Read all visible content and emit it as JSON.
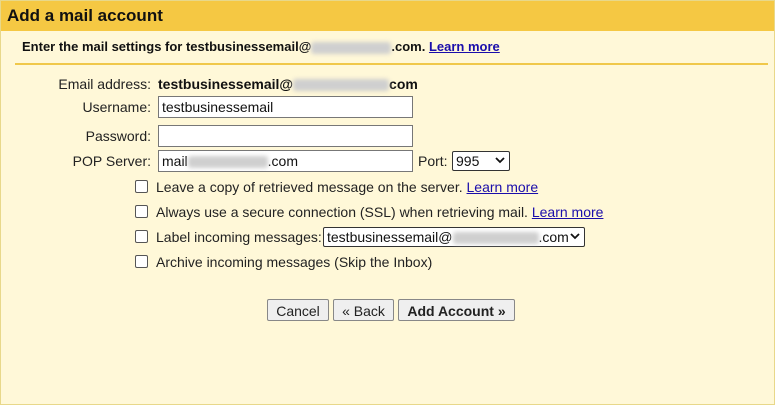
{
  "title": "Add a mail account",
  "intro": {
    "text_prefix": "Enter the mail settings for testbusinessemail@",
    "text_suffix": ".com.",
    "learn_more": "Learn more"
  },
  "form": {
    "email_label": "Email address:",
    "email_prefix": "testbusinessemail@",
    "email_suffix": "com",
    "username_label": "Username:",
    "username_value": "testbusinessemail",
    "password_label": "Password:",
    "password_value": "",
    "pop_label": "POP Server:",
    "pop_prefix": "mail",
    "pop_suffix": ".com",
    "port_label": "Port:",
    "port_value": "995"
  },
  "options": [
    {
      "label": "Leave a copy of retrieved message on the server.",
      "link": "Learn more",
      "checked": false
    },
    {
      "label": "Always use a secure connection (SSL) when retrieving mail.",
      "link": "Learn more",
      "checked": false
    },
    {
      "label": "Label incoming messages:",
      "select_prefix": "testbusinessemail@",
      "select_suffix": ".com",
      "checked": false
    },
    {
      "label": "Archive incoming messages (Skip the Inbox)",
      "checked": false
    }
  ],
  "buttons": {
    "cancel": "Cancel",
    "back": "« Back",
    "add": "Add Account »"
  },
  "colors": {
    "titlebar": "#f5c843",
    "background": "#fff8d8",
    "link": "#1a0dab"
  }
}
